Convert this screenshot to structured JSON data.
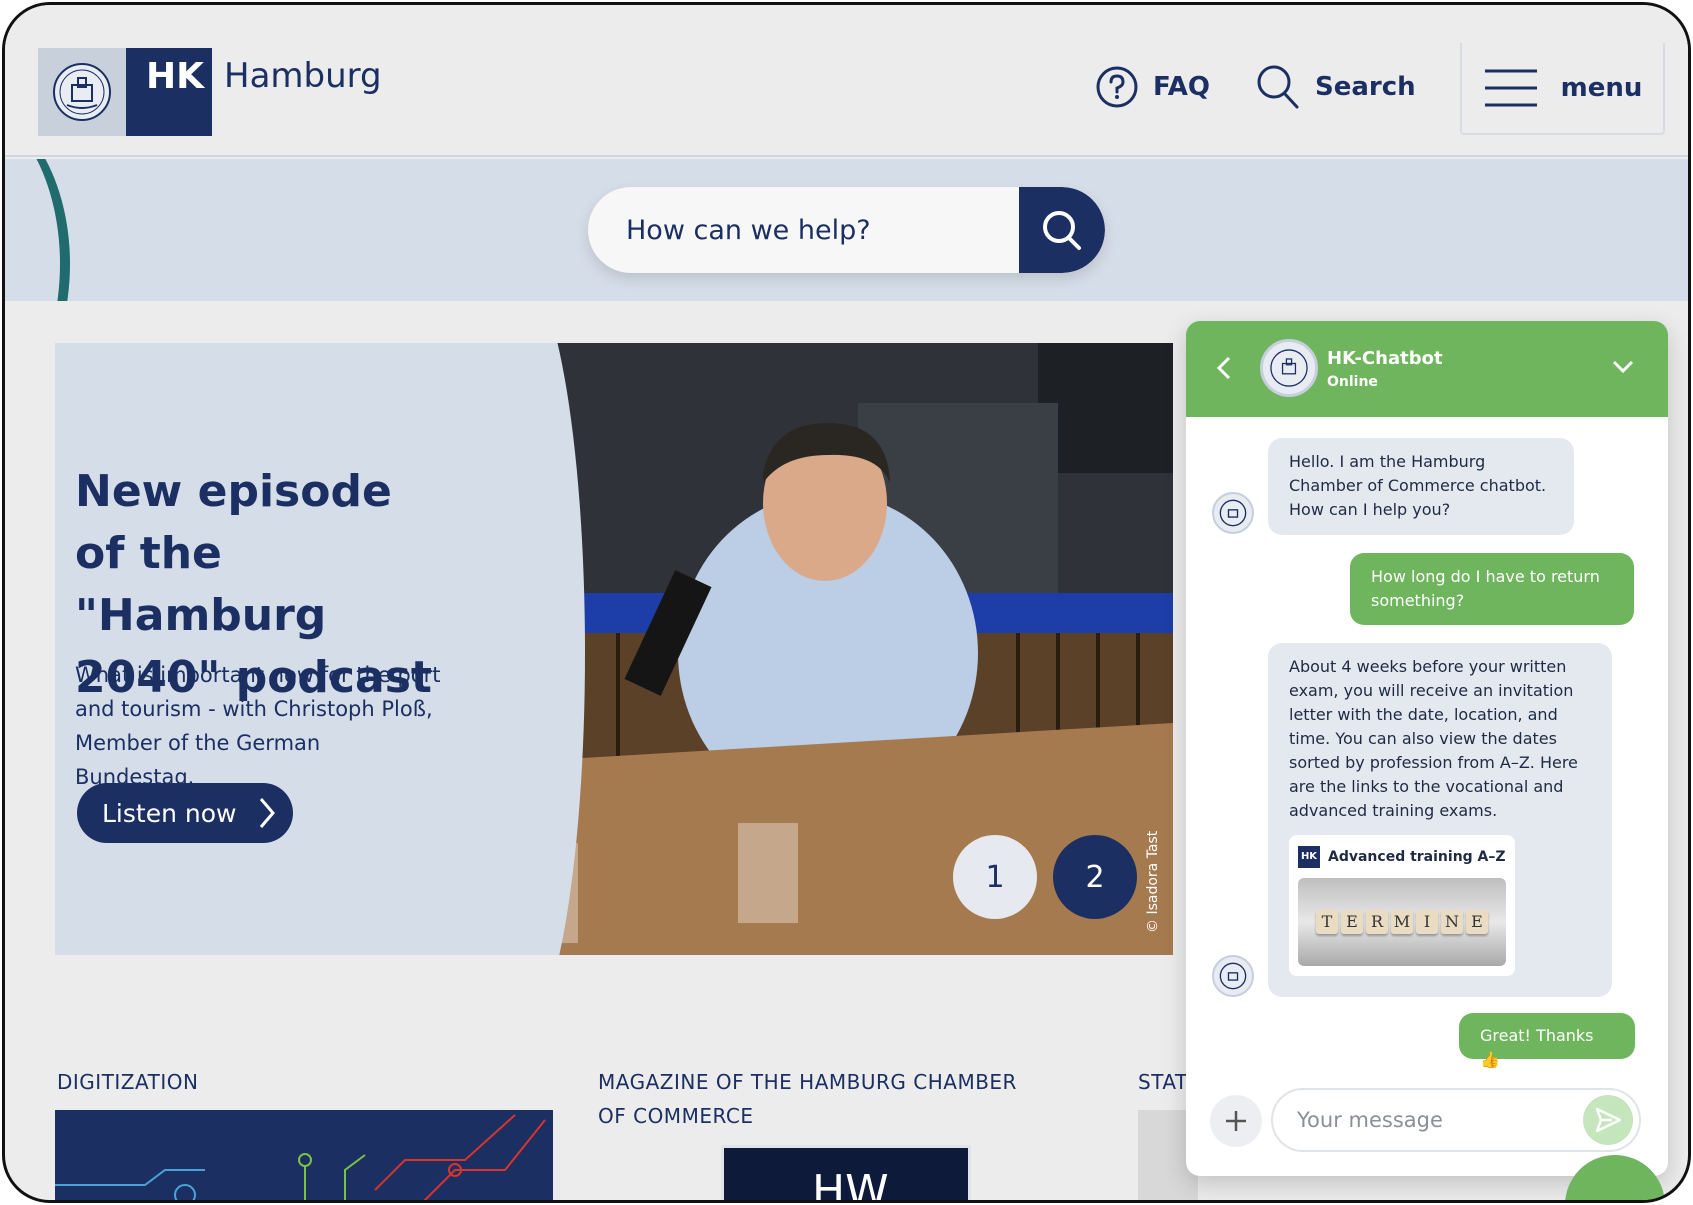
{
  "header": {
    "logo_abbr": "HK",
    "logo_city": "Hamburg",
    "faq_label": "FAQ",
    "search_label": "Search",
    "menu_label": "menu"
  },
  "search": {
    "placeholder": "How can we help?"
  },
  "hero": {
    "title": "New episode of the \"Hamburg 2040\" podcast",
    "subtitle": "What is important now for the port and tourism - with Christoph Ploß, Member of the German Bundestag.",
    "button_label": "Listen now",
    "photo_credit": "© Isadora Tast",
    "pages": [
      "1",
      "2"
    ],
    "current_page": 2
  },
  "sections": [
    {
      "label": "DIGITIZATION"
    },
    {
      "label": "MAGAZINE OF THE HAMBURG CHAMBER OF COMMERCE"
    },
    {
      "label": "STAT"
    }
  ],
  "chat": {
    "bot_name": "HK-Chatbot",
    "status": "Online",
    "messages": [
      {
        "from": "bot",
        "text": "Hello. I am the Hamburg Chamber of Commerce chatbot. How can I help you?"
      },
      {
        "from": "user",
        "text": "How long do I have to return something?"
      },
      {
        "from": "bot",
        "text": "About 4 weeks before your written exam, you will receive an invitation letter with the date, location, and time. You can also view the dates sorted by profession from A–Z. Here are the links to the vocational and advanced training exams."
      },
      {
        "from": "user",
        "text": "Great! Thanks 👍"
      }
    ],
    "link_card": {
      "tag": "HK",
      "title": "Advanced training A–Z",
      "image_word": [
        "T",
        "E",
        "R",
        "M",
        "I",
        "N",
        "E"
      ]
    },
    "input_placeholder": "Your message"
  },
  "colors": {
    "brand_navy": "#1b2f63",
    "chat_green": "#6fb55d",
    "band_blue": "#d5dde8",
    "accent_teal": "#1f6b6e"
  }
}
